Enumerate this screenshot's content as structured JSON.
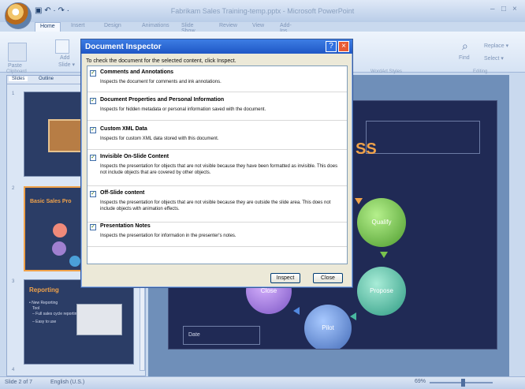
{
  "app": {
    "window_title": "Fabrikam Sales Training-temp.pptx - Microsoft PowerPoint",
    "quick_access": "▣ ↶ · ↷ ·",
    "tabs": [
      "Home",
      "Insert",
      "Design",
      "Animations",
      "Slide Show",
      "Review",
      "View",
      "Add-Ins"
    ],
    "ribbon": {
      "clipboard": "Clipboard",
      "paste": "Paste",
      "add_slide": "Add",
      "slide_menu": "Slide ▾",
      "wordart_styles": "WordArt Styles",
      "editing": "Editing",
      "find": "Find",
      "replace": "Replace ▾",
      "select": "Select ▾"
    }
  },
  "panel": {
    "tabs": [
      "Slides",
      "Outline"
    ],
    "slides": [
      {
        "number": "1",
        "title": ""
      },
      {
        "number": "2",
        "title": "Basic Sales Pro"
      },
      {
        "number": "3",
        "title": "Reporting",
        "bullets": [
          "• New Reporting",
          "Tool",
          "– Full sales cycle reporting",
          "– Easy to use"
        ]
      },
      {
        "number": "4",
        "title": ""
      }
    ]
  },
  "slide": {
    "title": "SS",
    "nodes": [
      "Qualify",
      "Propose",
      "Pilot",
      "Close"
    ],
    "date_box": "Date"
  },
  "dialog": {
    "title": "Document Inspector",
    "instruction": "To check the document for the selected content, click Inspect.",
    "items": [
      {
        "title": "Comments and Annotations",
        "desc": "Inspects the document for comments and ink annotations."
      },
      {
        "title": "Document Properties and Personal Information",
        "desc": "Inspects for hidden metadata or personal information saved with the document."
      },
      {
        "title": "Custom XML Data",
        "desc": "Inspects for custom XML data stored with this document."
      },
      {
        "title": "Invisible On-Slide Content",
        "desc": "Inspects the presentation for objects that are not visible because they have been formatted as invisible. This does not include objects that are covered by other objects."
      },
      {
        "title": "Off-Slide content",
        "desc": "Inspects the presentation for objects that are not visible because they are outside the slide area. This does not include objects with animation effects."
      },
      {
        "title": "Presentation Notes",
        "desc": "Inspects the presentation for information in the presenter's notes."
      }
    ],
    "inspect_button": "Inspect",
    "close_button": "Close"
  },
  "status": {
    "slide_info": "Slide 2 of 7",
    "language": "English (U.S.)",
    "zoom": "69%"
  },
  "colors": {
    "dialog_title": "#2a66d6",
    "slide_bg": "#202a55",
    "accent": "#f0a24a"
  },
  "icons": [
    "office-button-icon",
    "help-icon",
    "close-icon",
    "checkbox-icon"
  ]
}
